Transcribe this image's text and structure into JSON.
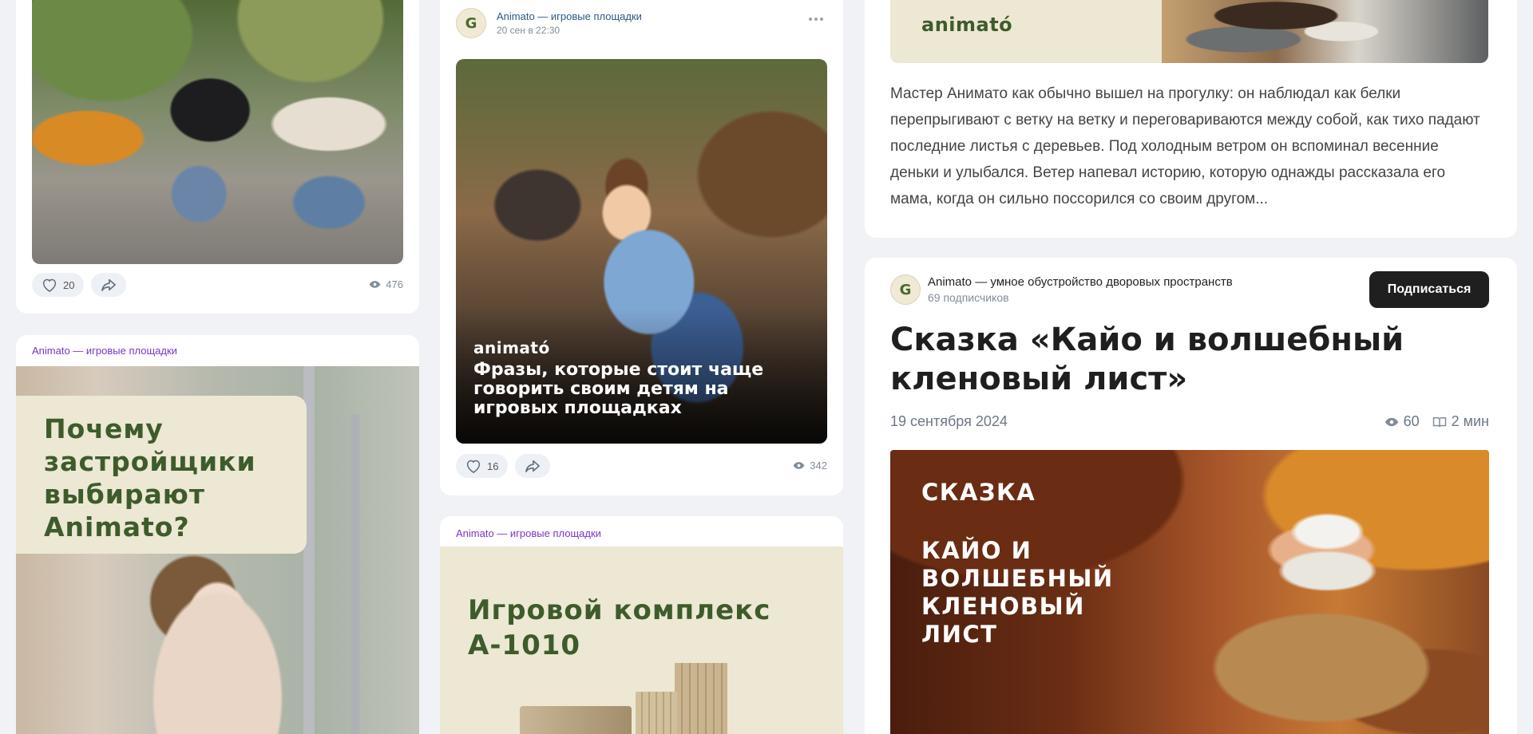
{
  "posts": {
    "family_walk": {
      "likes": "20",
      "views": "476"
    },
    "developers": {
      "source": "Animato — игровые площадки",
      "image_headline": "Почему застройщики выбирают Animato?"
    },
    "swing": {
      "author": "Animato — игровые площадки",
      "date": "20 сен в 22:30",
      "image_logo": "animató",
      "image_caption": "Фразы, которые стоит чаще говорить своим детям на игровых площадках",
      "likes": "16",
      "views": "342"
    },
    "complex": {
      "source": "Animato — игровые площадки",
      "image_headline": "Игровой комплекс А-1010"
    },
    "story_excerpt": {
      "banner_logo": "animató",
      "text": "Мастер Анимато как обычно вышел на прогулку: он наблюдал как белки перепрыгивают с ветку на ветку и переговариваются между собой, как тихо падают последние листья с деревьев. Под холодным ветром он вспоминал весенние деньки и улыбался. Ветер напевал историю, которую однажды рассказала его мама, когда он сильно поссорился со своим другом..."
    },
    "article": {
      "channel_name": "Animato — умное обустройство дворовых пространств",
      "subscribers": "69 подписчиков",
      "subscribe_label": "Подписаться",
      "title": "Сказка «Кайо и волшебный кленовый лист»",
      "date": "19 сентября 2024",
      "views": "60",
      "read_time": "2 мин",
      "image_title_1": "СКАЗКА",
      "image_title_2": "КАЙО И ВОЛШЕБНЫЙ КЛЕНОВЫЙ ЛИСТ"
    }
  },
  "avatar_letter": "G",
  "colors": {
    "accent_purple": "#7b35c9",
    "link_blue": "#2a5885",
    "brand_green": "#3e5b2c",
    "brand_cream": "#ece8d3",
    "button_dark": "#1f1f1f"
  },
  "icons": [
    "heart-icon",
    "share-icon",
    "eye-icon",
    "more-icon",
    "book-icon"
  ]
}
